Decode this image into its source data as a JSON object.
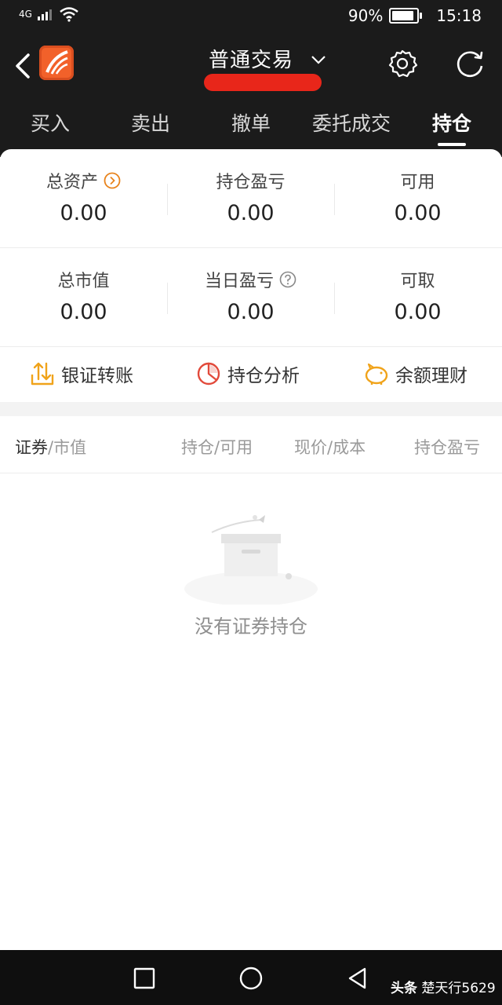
{
  "status_bar": {
    "network": "4G",
    "battery_percent": "90%",
    "time": "15:18",
    "battery_level": 0.9
  },
  "header": {
    "title": "普通交易",
    "icons": [
      "back-icon",
      "app-logo",
      "chevron-down-icon",
      "gear-icon",
      "refresh-icon"
    ]
  },
  "tabs": [
    {
      "label": "买入",
      "active": false
    },
    {
      "label": "卖出",
      "active": false
    },
    {
      "label": "撤单",
      "active": false
    },
    {
      "label": "委托成交",
      "active": false
    },
    {
      "label": "持仓",
      "active": true
    }
  ],
  "stats": {
    "row1": [
      {
        "label": "总资产",
        "value": "0.00",
        "icon": "circle-arrow-right-icon"
      },
      {
        "label": "持仓盈亏",
        "value": "0.00"
      },
      {
        "label": "可用",
        "value": "0.00"
      }
    ],
    "row2": [
      {
        "label": "总市值",
        "value": "0.00"
      },
      {
        "label": "当日盈亏",
        "value": "0.00",
        "icon": "question-circle-icon"
      },
      {
        "label": "可取",
        "value": "0.00"
      }
    ]
  },
  "actions": [
    {
      "label": "银证转账",
      "icon": "transfer-icon"
    },
    {
      "label": "持仓分析",
      "icon": "pie-chart-icon"
    },
    {
      "label": "余额理财",
      "icon": "piggy-bank-icon"
    }
  ],
  "table_header": {
    "col1_primary": "证券",
    "col1_secondary": "/市值",
    "col2": "持仓/可用",
    "col3": "现价/成本",
    "col4": "持仓盈亏"
  },
  "empty_state": {
    "message": "没有证券持仓",
    "icon": "empty-box-icon"
  },
  "watermark": {
    "brand": "头条",
    "author": "楚天行5629"
  },
  "colors": {
    "header_bg": "#1b1b1b",
    "accent_orange": "#e8831c",
    "analysis_red": "#e24a3b",
    "logo_orange": "#f2612a",
    "finance_yellow": "#f0a31a"
  }
}
